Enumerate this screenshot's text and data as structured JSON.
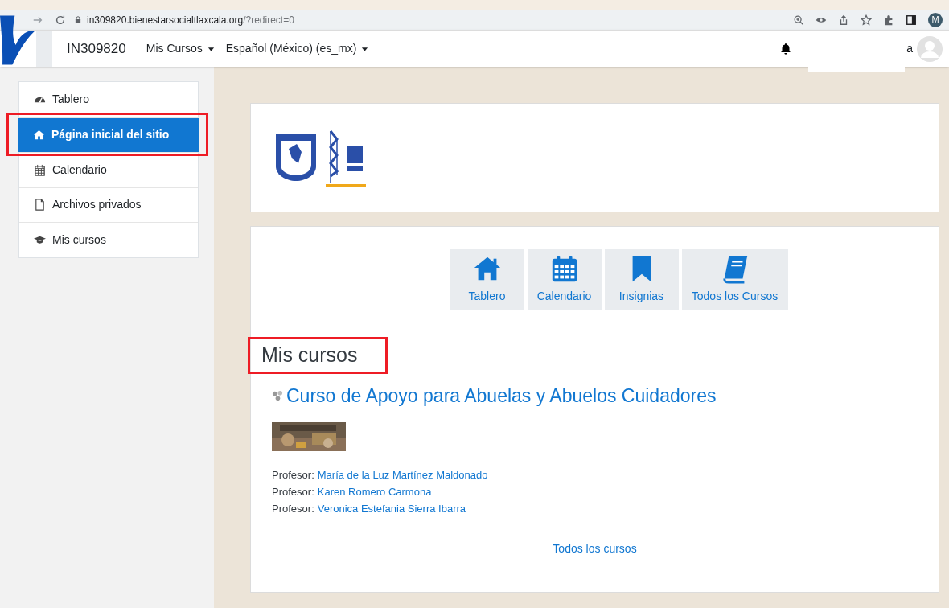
{
  "browser": {
    "url_host": "in309820.bienestarsocialtlaxcala.org",
    "url_path": "/?redirect=0",
    "profile_initial": "M"
  },
  "navbar": {
    "site_name": "IN309820",
    "menus": [
      {
        "label": "Mis Cursos"
      },
      {
        "label": "Español (México) (es_mx)"
      }
    ],
    "user_text": "a"
  },
  "sidebar": {
    "items": [
      {
        "label": "Tablero",
        "selected": false
      },
      {
        "label": "Página inicial del sitio",
        "selected": true
      },
      {
        "label": "Calendario",
        "selected": false
      },
      {
        "label": "Archivos privados",
        "selected": false
      },
      {
        "label": "Mis cursos",
        "selected": false
      }
    ]
  },
  "quick_links": [
    {
      "label": "Tablero"
    },
    {
      "label": "Calendario"
    },
    {
      "label": "Insignias"
    },
    {
      "label": "Todos los Cursos"
    }
  ],
  "section_title": "Mis cursos",
  "course": {
    "title": "Curso de Apoyo para Abuelas y Abuelos Cuidadores",
    "teachers": [
      {
        "role": "Profesor:",
        "name": "María de la Luz Martínez Maldonado"
      },
      {
        "role": "Profesor:",
        "name": "Karen Romero Carmona"
      },
      {
        "role": "Profesor:",
        "name": "Veronica Estefania Sierra Ibarra"
      }
    ]
  },
  "all_courses_link": "Todos los cursos"
}
